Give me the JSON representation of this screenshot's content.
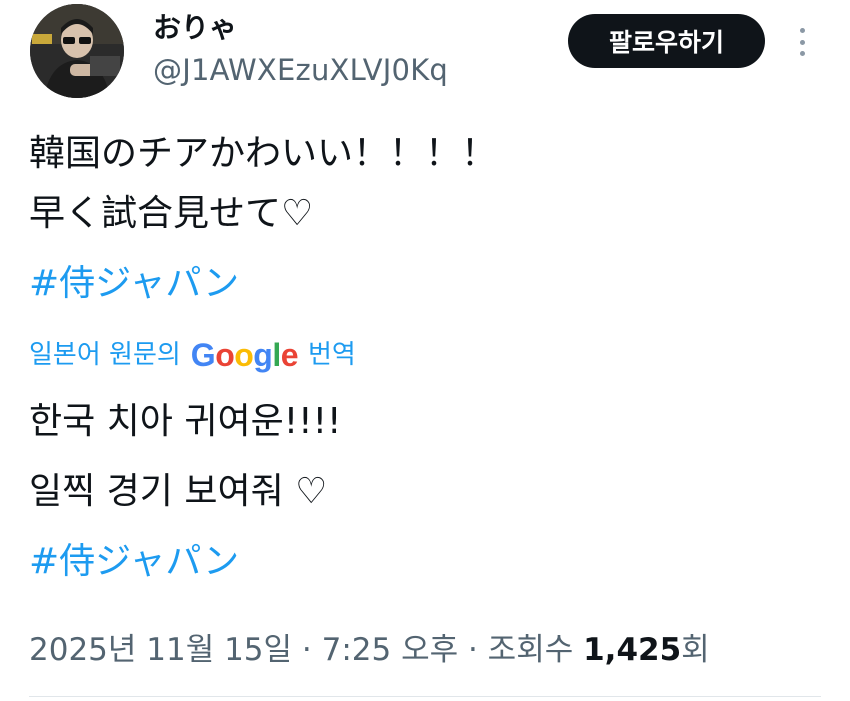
{
  "author": {
    "display_name": "おりゃ",
    "handle": "@J1AWXEzuXLVJ0Kq"
  },
  "follow_label": "팔로우하기",
  "tweet": {
    "lines": [
      "韓国のチアかわいい！！！！",
      "早く試合見せて♡"
    ],
    "hashtag": "#侍ジャパン"
  },
  "translation": {
    "prefix": "일본어 원문의",
    "google": [
      "G",
      "o",
      "o",
      "g",
      "l",
      "e"
    ],
    "google_colors": [
      "#4285F4",
      "#EA4335",
      "#FBBC05",
      "#4285F4",
      "#34A853",
      "#EA4335"
    ],
    "suffix": "번역",
    "lines": [
      "한국 치아 귀여운!!!!",
      "일찍 경기 보여줘 ♡"
    ],
    "hashtag": "#侍ジャパン"
  },
  "meta": {
    "timestamp": "2025년 11월 15일 · 7:25 오후 · 조회수 ",
    "view_count": "1,425",
    "view_suffix": "회"
  },
  "colors": {
    "accent": "#1d9bf0",
    "text": "#0f1419",
    "muted": "#536471"
  }
}
